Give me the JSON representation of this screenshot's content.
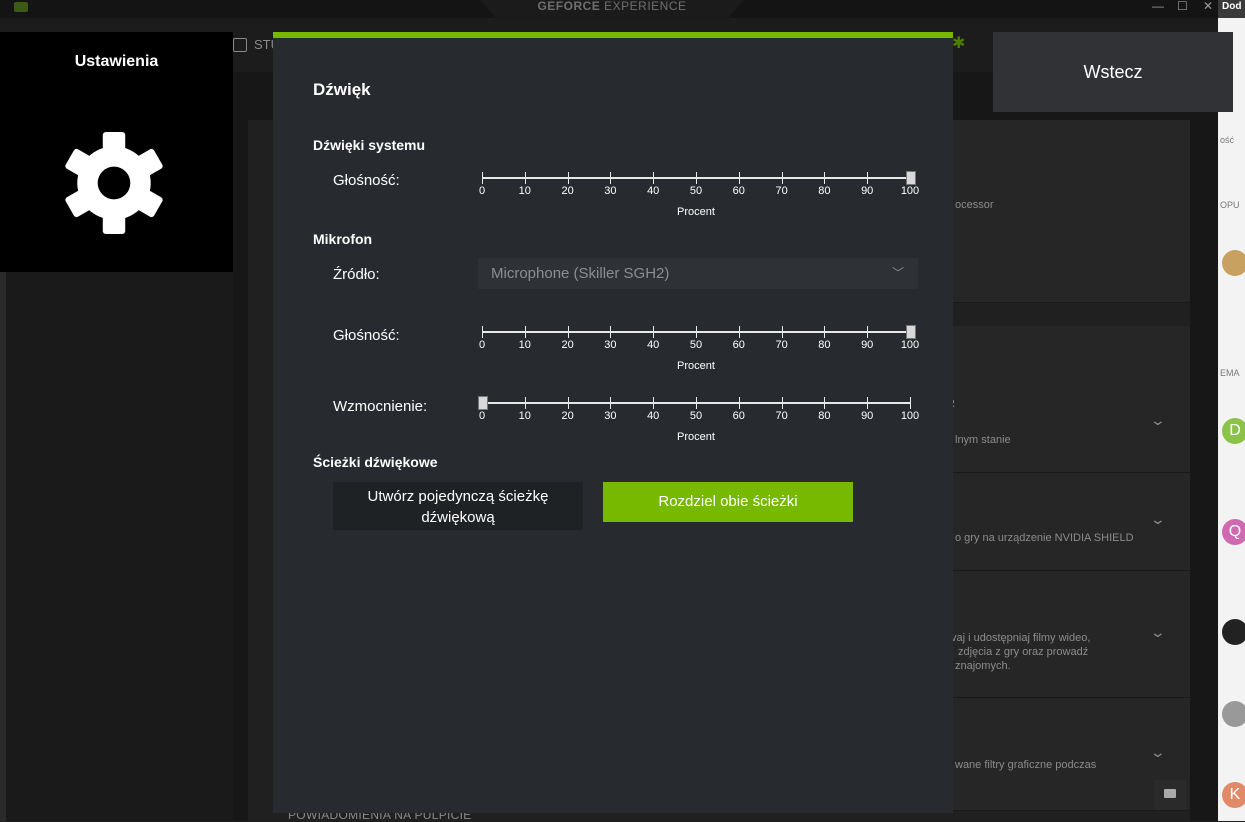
{
  "app": {
    "brand_bold": "GEFORCE",
    "brand_light": "EXPERIENCE",
    "top_tab": "STU",
    "browser_tab": "Dod",
    "window_controls": {
      "minimize": "—",
      "maximize": "☐",
      "close": "✕"
    }
  },
  "sidebar_tile": {
    "title": "Ustawienia",
    "icon": "gear-icon"
  },
  "back_button": {
    "label": "Wstecz"
  },
  "background": {
    "cards": [
      {
        "text": "ocessor"
      },
      {
        "text": "R",
        "subtext": "lnym stanie"
      },
      {
        "text": "o gry na urządzenie NVIDIA SHIELD"
      },
      {
        "text": "vaj i udostępniaj filmy wideo,",
        "text2": "zdjęcia z gry oraz prowadź",
        "text3": "znajomych."
      },
      {
        "text": "wane filtry graficzne podczas"
      }
    ],
    "bottom_text": "POWIADOMIENIA NA PULPICIE",
    "browser_labels": [
      "ość",
      "OPU",
      "EMA"
    ],
    "browser_avatars": [
      "D",
      "Q",
      "K"
    ]
  },
  "dialog": {
    "title": "Dźwięk",
    "accent_color": "#76b900",
    "system_sounds": {
      "heading": "Dźwięki systemu",
      "volume_label": "Głośność:",
      "volume_value": 100
    },
    "microphone": {
      "heading": "Mikrofon",
      "source_label": "Źródło:",
      "source_value": "Microphone (Skiller SGH2)",
      "volume_label": "Głośność:",
      "volume_value": 100,
      "boost_label": "Wzmocnienie:",
      "boost_value": 0
    },
    "slider_ticks": [
      "0",
      "10",
      "20",
      "30",
      "40",
      "50",
      "60",
      "70",
      "80",
      "90",
      "100"
    ],
    "slider_unit": "Procent",
    "audio_tracks": {
      "heading": "Ścieżki dźwiękowe",
      "single_track_button": "Utwórz pojedynczą ścieżkę dźwiękową",
      "split_tracks_button": "Rozdziel obie ścieżki"
    }
  }
}
